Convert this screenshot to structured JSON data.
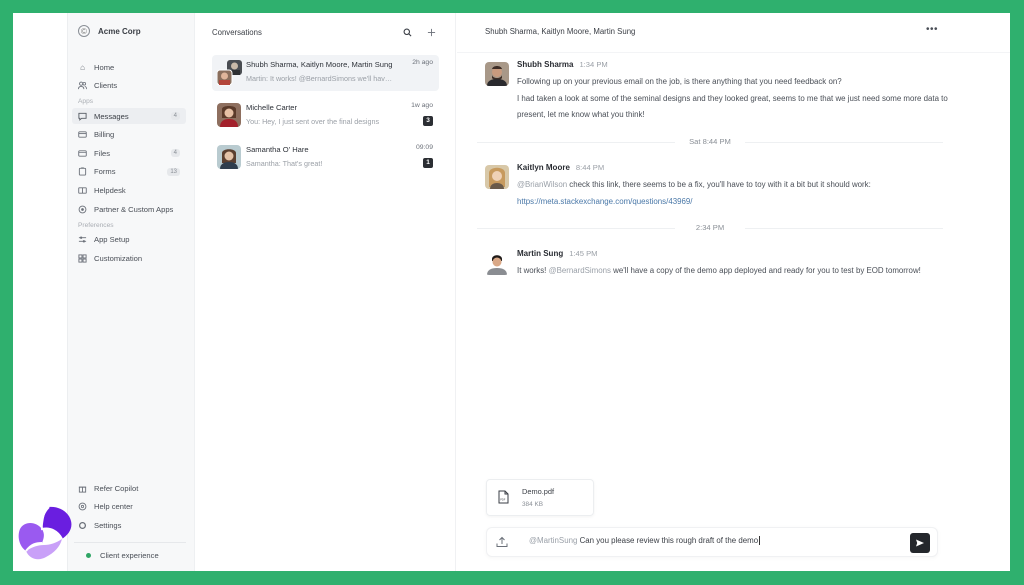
{
  "brand": {
    "name": "Acme Corp",
    "logo_icon": "copyright-circle-icon"
  },
  "sidebar": {
    "top_items": [
      {
        "label": "Home",
        "icon": "home-icon"
      },
      {
        "label": "Clients",
        "icon": "users-icon"
      }
    ],
    "apps_section": "Apps",
    "apps_items": [
      {
        "label": "Messages",
        "icon": "message-icon",
        "badge": "4",
        "active": true
      },
      {
        "label": "Billing",
        "icon": "credit-card-icon"
      },
      {
        "label": "Files",
        "icon": "folder-icon",
        "badge": "4"
      },
      {
        "label": "Forms",
        "icon": "clipboard-icon",
        "badge": "13"
      },
      {
        "label": "Helpdesk",
        "icon": "book-icon"
      },
      {
        "label": "Partner & Custom Apps",
        "icon": "target-icon"
      }
    ],
    "preferences_section": "Preferences",
    "preferences_items": [
      {
        "label": "App Setup",
        "icon": "sliders-icon"
      },
      {
        "label": "Customization",
        "icon": "grid-icon"
      }
    ],
    "bottom_items": [
      {
        "label": "Refer Copilot",
        "icon": "gift-icon"
      },
      {
        "label": "Help center",
        "icon": "help-icon"
      },
      {
        "label": "Settings",
        "icon": "gear-icon"
      }
    ],
    "client_experience": "Client experience",
    "status_color": "#2fa565"
  },
  "conversations": {
    "title": "Conversations",
    "items": [
      {
        "name": "Shubh Sharma, Kaitlyn Moore, Martin Sung",
        "preview": "Martin: It works! @BernardSimons we'll have a copy",
        "time": "2h ago",
        "badge": null,
        "active": true
      },
      {
        "name": "Michelle Carter",
        "preview": "You: Hey, I just sent over the final designs",
        "time": "1w ago",
        "badge": "3"
      },
      {
        "name": "Samantha O' Hare",
        "preview": "Samantha: That's great!",
        "time": "09:09",
        "badge": "1"
      }
    ]
  },
  "chat": {
    "title": "Shubh Sharma, Kaitlyn Moore, Martin Sung",
    "messages": [
      {
        "author": "Shubh Sharma",
        "time": "1:34 PM",
        "lines": [
          "Following up on your previous email on the job, is there anything that you need feedback on?",
          "I had taken a look at some of the seminal designs and they looked great, seems to me that we just need some more data to present, let me know what you think!"
        ]
      },
      {
        "author": "Kaitlyn Moore",
        "time": "8:44 PM",
        "mention": "@BrianWilson",
        "text": " check this link, there seems to be a fix, you'll have to toy with it a bit but it should work: ",
        "link": "https://meta.stackexchange.com/questions/43969/"
      },
      {
        "author": "Martin Sung",
        "time": "1:45 PM",
        "prefix": "It works! ",
        "mention": "@BernardSimons",
        "text": " we'll have a copy of the demo app deployed and ready for you to test by EOD tomorrow!"
      }
    ],
    "dividers": [
      "Sat 8:44 PM",
      "2:34 PM"
    ],
    "attachment": {
      "name": "Demo.pdf",
      "size": "384 KB",
      "icon": "pdf-file-icon"
    },
    "composer": {
      "mention": "@MartinSung",
      "text": " Can you please review this rough draft of the demo"
    }
  },
  "colors": {
    "frame": "#2fb06e",
    "send_button": "#24272c",
    "link": "#4a78a8"
  }
}
